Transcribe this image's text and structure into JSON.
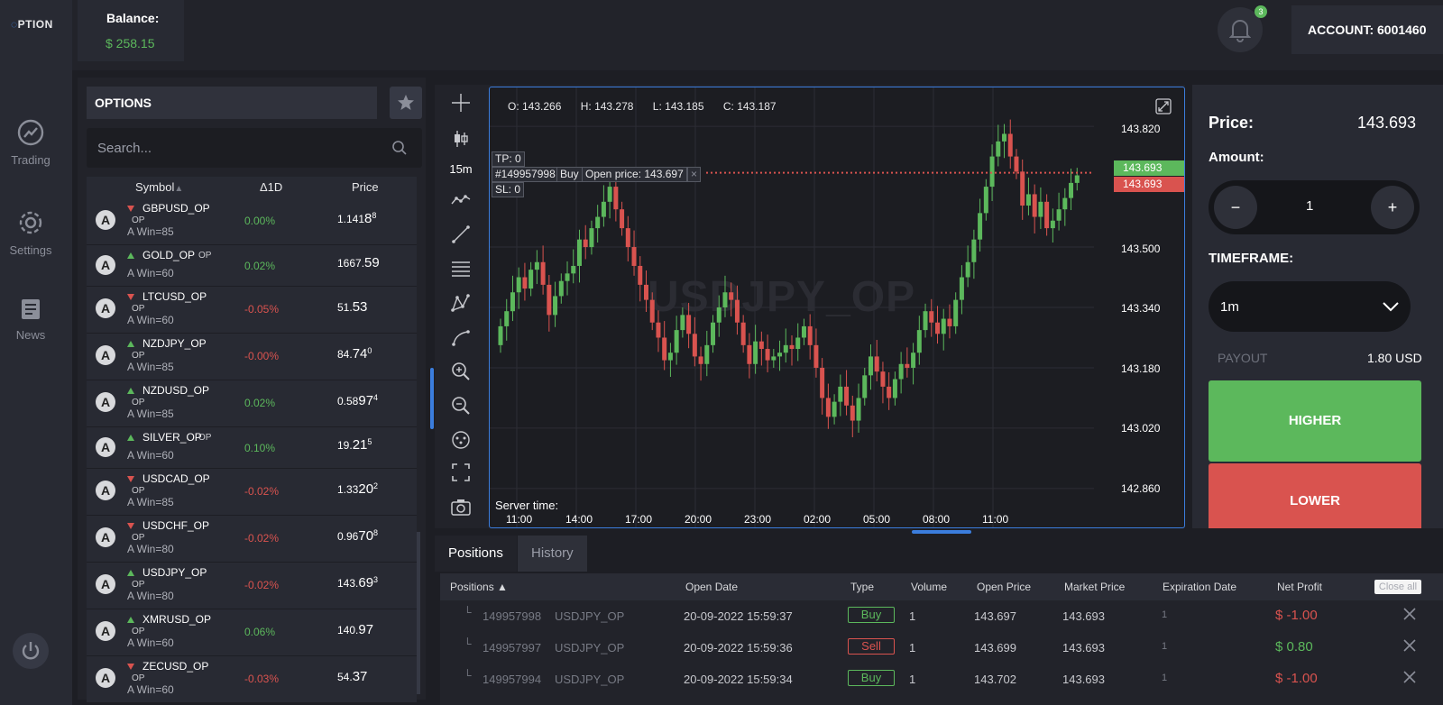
{
  "nav": {
    "logo": "PTION",
    "items": [
      {
        "label": "Trading",
        "icon": "trend-chart-icon"
      },
      {
        "label": "Settings",
        "icon": "gear-icon"
      },
      {
        "label": "News",
        "icon": "news-icon"
      }
    ]
  },
  "topbar": {
    "balance_label": "Balance:",
    "balance_value": "$ 258.15",
    "notifications_count": "3",
    "account": "ACCOUNT: 6001460"
  },
  "options": {
    "title": "OPTIONS",
    "search_placeholder": "Search...",
    "columns": {
      "symbol": "Symbol",
      "change": "Δ1D",
      "price": "Price"
    },
    "rows": [
      {
        "avatar": "A",
        "symbol": "GBPUSD_OP",
        "op": "OP",
        "win": "A Win=85",
        "change": "0.00%",
        "price_main": "1.141",
        "price_big": "8",
        "price_sup": "8",
        "direction": "down",
        "change_color": "green",
        "op_inline": false
      },
      {
        "avatar": "A",
        "symbol": "GOLD_OP",
        "op": "OP",
        "win": "A Win=60",
        "change": "0.02%",
        "price_main": "1667.",
        "price_big": "59",
        "price_sup": "",
        "direction": "up",
        "change_color": "green",
        "op_inline": true
      },
      {
        "avatar": "A",
        "symbol": "LTCUSD_OP",
        "op": "OP",
        "win": "A Win=60",
        "change": "-0.05%",
        "price_main": "51.",
        "price_big": "53",
        "price_sup": "",
        "direction": "down",
        "change_color": "red",
        "op_inline": false
      },
      {
        "avatar": "A",
        "symbol": "NZDJPY_OP",
        "op": "OP",
        "win": "A Win=85",
        "change": "-0.00%",
        "price_main": "84.",
        "price_big": "74",
        "price_sup": "0",
        "direction": "up",
        "change_color": "red",
        "op_inline": false
      },
      {
        "avatar": "A",
        "symbol": "NZDUSD_OP",
        "op": "OP",
        "win": "A Win=85",
        "change": "0.02%",
        "price_main": "0.58",
        "price_big": "97",
        "price_sup": "4",
        "direction": "up",
        "change_color": "green",
        "op_inline": false
      },
      {
        "avatar": "A",
        "symbol": "SILVER_OP",
        "op": "OP",
        "win": "A Win=60",
        "change": "0.10%",
        "price_main": "19.",
        "price_big": "21",
        "price_sup": "5",
        "direction": "up",
        "change_color": "green",
        "op_inline": true
      },
      {
        "avatar": "A",
        "symbol": "USDCAD_OP",
        "op": "OP",
        "win": "A Win=85",
        "change": "-0.02%",
        "price_main": "1.33",
        "price_big": "20",
        "price_sup": "2",
        "direction": "down",
        "change_color": "red",
        "op_inline": false
      },
      {
        "avatar": "A",
        "symbol": "USDCHF_OP",
        "op": "OP",
        "win": "A Win=80",
        "change": "-0.02%",
        "price_main": "0.96",
        "price_big": "70",
        "price_sup": "8",
        "direction": "down",
        "change_color": "red",
        "op_inline": false
      },
      {
        "avatar": "A",
        "symbol": "USDJPY_OP",
        "op": "OP",
        "win": "A Win=80",
        "change": "-0.02%",
        "price_main": "143.",
        "price_big": "69",
        "price_sup": "3",
        "direction": "up",
        "change_color": "red",
        "op_inline": false
      },
      {
        "avatar": "A",
        "symbol": "XMRUSD_OP",
        "op": "OP",
        "win": "A Win=60",
        "change": "0.06%",
        "price_main": "140.",
        "price_big": "97",
        "price_sup": "",
        "direction": "up",
        "change_color": "green",
        "op_inline": false
      },
      {
        "avatar": "A",
        "symbol": "ZECUSD_OP",
        "op": "OP",
        "win": "A Win=60",
        "change": "-0.03%",
        "price_main": "54.",
        "price_big": "37",
        "price_sup": "",
        "direction": "down",
        "change_color": "red",
        "op_inline": false
      }
    ]
  },
  "chart": {
    "timeframe_label": "15m",
    "ohlc": {
      "o": "O: 143.266",
      "h": "H: 143.278",
      "l": "L: 143.185",
      "c": "C: 143.187"
    },
    "watermark": "USDJPY_OP",
    "position_line": {
      "tp": "TP: 0",
      "id": "#149957998",
      "type": "Buy",
      "open": "Open price: 143.697",
      "sl": "SL: 0",
      "close": "×"
    },
    "server_time_label": "Server time:",
    "ask_tag": "143.693",
    "bid_tag": "143.693",
    "colors": {
      "up": "#5cb85c",
      "down": "#d9534f",
      "accent": "#3b7ddd"
    }
  },
  "chart_data": {
    "type": "candlestick",
    "title": "USDJPY_OP",
    "x_ticks": [
      "11:00",
      "14:00",
      "17:00",
      "20:00",
      "23:00",
      "02:00",
      "05:00",
      "08:00",
      "11:00"
    ],
    "y_ticks": [
      143.82,
      143.5,
      143.34,
      143.18,
      143.02,
      142.86
    ],
    "ylim": [
      142.8,
      143.88
    ],
    "close": [
      143.29,
      143.33,
      143.38,
      143.42,
      143.39,
      143.44,
      143.46,
      143.4,
      143.32,
      143.37,
      143.41,
      143.43,
      143.45,
      143.52,
      143.5,
      143.55,
      143.58,
      143.62,
      143.66,
      143.6,
      143.55,
      143.5,
      143.45,
      143.4,
      143.36,
      143.3,
      143.26,
      143.2,
      143.22,
      143.28,
      143.32,
      143.27,
      143.21,
      143.19,
      143.24,
      143.3,
      143.34,
      143.38,
      143.36,
      143.3,
      143.24,
      143.19,
      143.25,
      143.23,
      143.2,
      143.21,
      143.22,
      143.24,
      143.23,
      143.26,
      143.29,
      143.24,
      143.18,
      143.1,
      143.05,
      143.09,
      143.13,
      143.08,
      143.04,
      143.1,
      143.16,
      143.21,
      143.17,
      143.13,
      143.1,
      143.15,
      143.19,
      143.18,
      143.22,
      143.28,
      143.33,
      143.3,
      143.27,
      143.31,
      143.29,
      143.36,
      143.42,
      143.46,
      143.52,
      143.59,
      143.66,
      143.74,
      143.78,
      143.8,
      143.74,
      143.7,
      143.61,
      143.64,
      143.58,
      143.62,
      143.55,
      143.57,
      143.6,
      143.63,
      143.67,
      143.69
    ],
    "current_price": 143.693,
    "open_price_line": 143.697
  },
  "trade": {
    "price_label": "Price:",
    "price_value": "143.693",
    "amount_label": "Amount:",
    "amount_value": "1",
    "minus": "−",
    "plus": "+",
    "timeframe_label": "TIMEFRAME:",
    "timeframe_value": "1m",
    "payout_label": "PAYOUT",
    "payout_value": "1.80 USD",
    "higher": "HIGHER",
    "lower": "LOWER"
  },
  "positions": {
    "tabs": [
      "Positions",
      "History"
    ],
    "columns": [
      "Positions ▲",
      "Open Date",
      "Type",
      "Volume",
      "Open Price",
      "Market Price",
      "Expiration Date",
      "Net Profit"
    ],
    "close_all": "Close all",
    "rows": [
      {
        "lead": "└",
        "id": "149957998",
        "symbol": "USDJPY_OP",
        "date": "20-09-2022 15:59:37",
        "type": "Buy",
        "volume": "1",
        "open": "143.697",
        "market": "143.693",
        "exp": "1",
        "net": "$ -1.00",
        "net_color": "red"
      },
      {
        "lead": "└",
        "id": "149957997",
        "symbol": "USDJPY_OP",
        "date": "20-09-2022 15:59:36",
        "type": "Sell",
        "volume": "1",
        "open": "143.699",
        "market": "143.693",
        "exp": "1",
        "net": "$ 0.80",
        "net_color": "green"
      },
      {
        "lead": "└",
        "id": "149957994",
        "symbol": "USDJPY_OP",
        "date": "20-09-2022 15:59:34",
        "type": "Buy",
        "volume": "1",
        "open": "143.702",
        "market": "143.693",
        "exp": "1",
        "net": "$ -1.00",
        "net_color": "red"
      }
    ]
  }
}
